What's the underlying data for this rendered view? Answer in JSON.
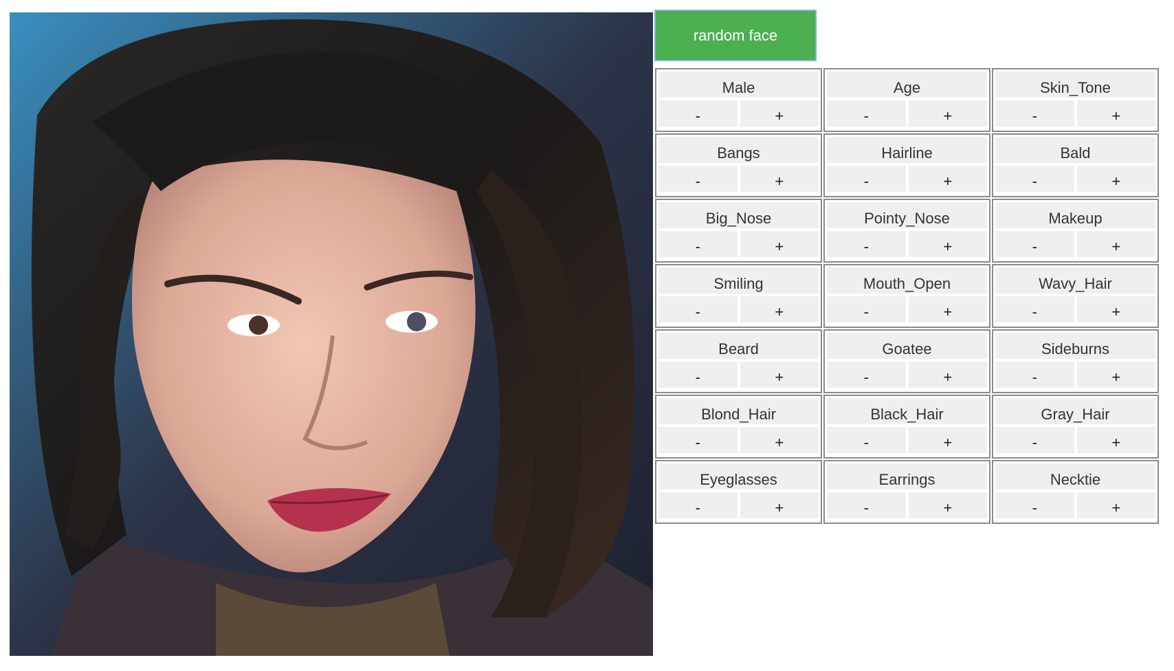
{
  "image": {
    "alt": "",
    "icon": "face-portrait"
  },
  "controls": {
    "random_button_label": "random face",
    "minus_label": "-",
    "plus_label": "+",
    "attributes": [
      "Male",
      "Age",
      "Skin_Tone",
      "Bangs",
      "Hairline",
      "Bald",
      "Big_Nose",
      "Pointy_Nose",
      "Makeup",
      "Smiling",
      "Mouth_Open",
      "Wavy_Hair",
      "Beard",
      "Goatee",
      "Sideburns",
      "Blond_Hair",
      "Black_Hair",
      "Gray_Hair",
      "Eyeglasses",
      "Earrings",
      "Necktie"
    ]
  },
  "colors": {
    "button_green": "#4caf50",
    "cell_border": "#8a8a8a",
    "cell_bg": "#efefef"
  }
}
